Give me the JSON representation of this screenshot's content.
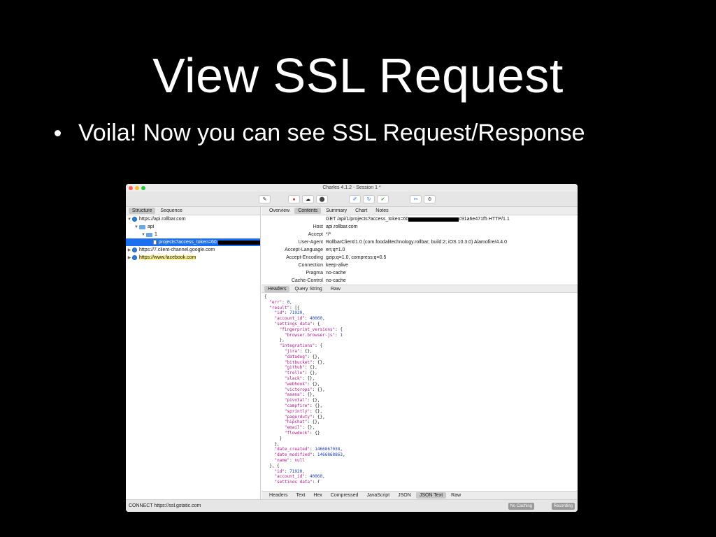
{
  "slide": {
    "title": "View SSL Request",
    "bullet": "Voila! Now you can see SSL Request/Response"
  },
  "app": {
    "window_title": "Charles 4.1.2 - Session 1 *",
    "toolbar_icons": [
      "pen-icon",
      "record-icon",
      "throttle-icon",
      "breakpoint-icon",
      "compose-icon",
      "repeat-icon",
      "validate-icon",
      "tools-icon",
      "settings-icon"
    ],
    "toolbar_glyphs": [
      "✎",
      "●",
      "☁",
      "⬤",
      "✐",
      "↻",
      "✔",
      "✂",
      "⚙"
    ],
    "view_tabs": [
      "Structure",
      "Sequence"
    ],
    "detail_tabs": [
      "Overview",
      "Contents",
      "Summary",
      "Chart",
      "Notes"
    ],
    "tree": [
      {
        "label": "https://api.rollbar.com"
      },
      {
        "label": "api"
      },
      {
        "label": "1"
      },
      {
        "label": "projects?access_token=60"
      },
      {
        "label": "https://7.client-channel.google.com"
      },
      {
        "label": "https://www.facebook.com"
      }
    ],
    "request_headers": [
      {
        "key": "",
        "value": "GET /api/1/projects?access_token=60",
        "value2": "c91a6e471f5 HTTP/1.1"
      },
      {
        "key": "Host",
        "value": "api.rollbar.com"
      },
      {
        "key": "Accept",
        "value": "*/*"
      },
      {
        "key": "User-Agent",
        "value": "RollbarClient/1.0 (com.foodalitechnology.rollbar; build:2; iOS 10.3.0) Alamofire/4.4.0"
      },
      {
        "key": "Accept-Language",
        "value": "en;q=1.0"
      },
      {
        "key": "Accept-Encoding",
        "value": "gzip;q=1.0, compress;q=0.5"
      },
      {
        "key": "Connection",
        "value": "keep-alive"
      },
      {
        "key": "Pragma",
        "value": "no-cache"
      },
      {
        "key": "Cache-Control",
        "value": "no-cache"
      }
    ],
    "sub_tabs": [
      "Headers",
      "Query String",
      "Raw"
    ],
    "response_tabs": [
      "Headers",
      "Text",
      "Hex",
      "Compressed",
      "JavaScript",
      "JSON",
      "JSON Text",
      "Raw"
    ],
    "status_text": "CONNECT https://ssl.gstatic.com",
    "status_buttons": [
      "No Caching",
      "Recording"
    ],
    "json_lines": [
      "{",
      "  \"err\": 0,",
      "  \"result\": [{",
      "    \"id\": 71920,",
      "    \"account_id\": 40060,",
      "    \"settings_data\": {",
      "      \"fingerprint_versions\": {",
      "        \"browser.browser-js\": 1",
      "      },",
      "      \"integrations\": {",
      "        \"jira\": {},",
      "        \"datadog\": {},",
      "        \"bitbucket\": {},",
      "        \"github\": {},",
      "        \"trello\": {},",
      "        \"slack\": {},",
      "        \"webhook\": {},",
      "        \"victorops\": {},",
      "        \"asana\": {},",
      "        \"pivotal\": {},",
      "        \"campfire\": {},",
      "        \"sprintly\": {},",
      "        \"pagerduty\": {},",
      "        \"hipchat\": {},",
      "        \"email\": {},",
      "        \"flowdock\": {}",
      "      }",
      "    },",
      "    \"date_created\": 1466867038,",
      "    \"date_modified\": 1466868863,",
      "    \"name\": null",
      "  }, {",
      "    \"id\": 71920,",
      "    \"account_id\": 40060,",
      "    \"settings_data\": {"
    ]
  }
}
